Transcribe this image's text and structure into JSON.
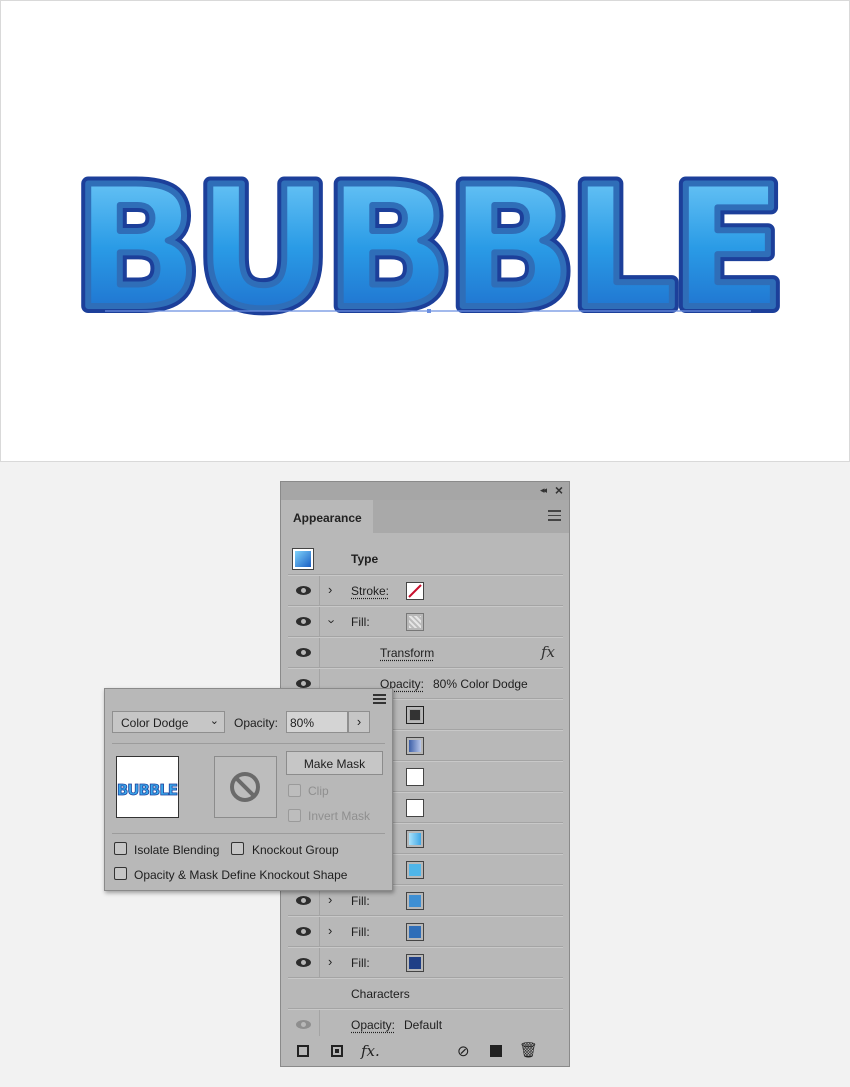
{
  "artwork": {
    "text": "BUBBLE"
  },
  "panel": {
    "tab_label": "Appearance",
    "header_label": "Type",
    "rows": [
      {
        "label": "Stroke:",
        "swatch": "none-red-slash"
      },
      {
        "label": "Fill:",
        "swatch": "pattern-gray"
      },
      {
        "label": "Transform"
      },
      {
        "label": "Opacity:",
        "value": "80% Color Dodge"
      },
      {
        "swatch": "#333333"
      },
      {
        "swatch": "#5a7fbf"
      },
      {
        "swatch": "#ffffff"
      },
      {
        "swatch": "#ffffff"
      },
      {
        "swatch": "#6cc6ef"
      },
      {
        "swatch": "#4fb6ea"
      },
      {
        "label": "Fill:",
        "swatch": "#3e8fd3"
      },
      {
        "label": "Fill:",
        "swatch": "#2f6eb8"
      },
      {
        "label": "Fill:",
        "swatch": "#1f3f86"
      }
    ],
    "characters_label": "Characters",
    "opacity_default_label": "Opacity:",
    "opacity_default_value": "Default"
  },
  "popup": {
    "blend_mode": "Color Dodge",
    "opacity_label": "Opacity:",
    "opacity_value": "80%",
    "thumbnail_text": "BUBBLE",
    "make_mask": "Make Mask",
    "clip": "Clip",
    "invert_mask": "Invert Mask",
    "isolate_blending": "Isolate Blending",
    "knockout_group": "Knockout Group",
    "opacity_mask_knockout": "Opacity & Mask Define Knockout Shape"
  },
  "colors": {
    "panel_bg": "#b8b8b8",
    "bubble_blue": "#2a9be6",
    "bubble_outline": "#1c3f9a"
  }
}
